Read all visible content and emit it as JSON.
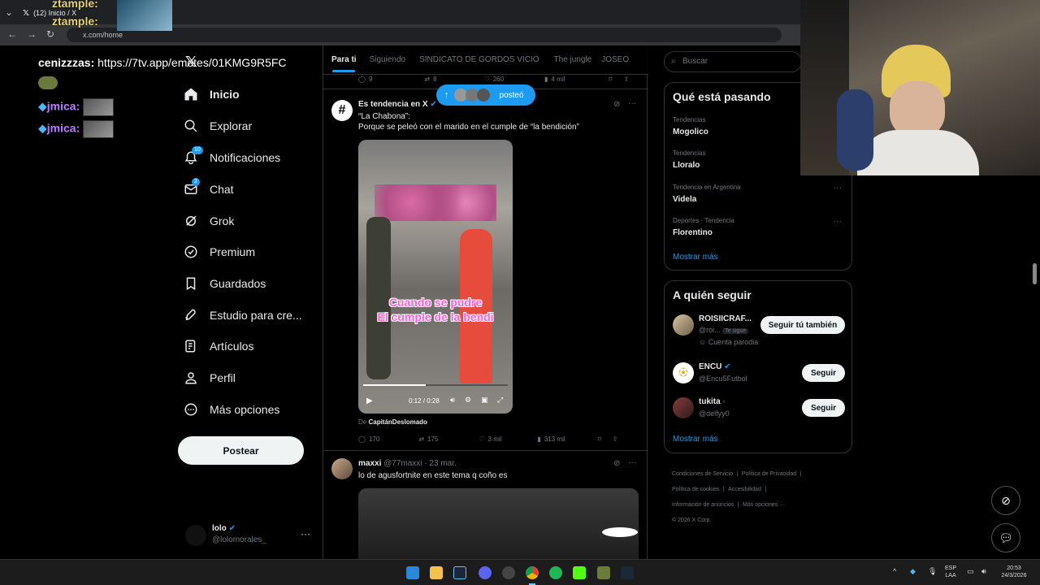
{
  "browser": {
    "tab_title": "(12) Inicio / X",
    "url": "x.com/home",
    "tab_close": "✕",
    "new_tab": "+"
  },
  "chat": {
    "top1": "ztample:",
    "top2": "ztample:",
    "line1_user": "cenizzzas:",
    "line1_text": "https://7tv.app/emotes/01KMG9R5FC",
    "line2_user": "jmica:",
    "line3_user": "jmica:"
  },
  "nav": {
    "items": [
      {
        "label": "Inicio",
        "icon": "home-icon"
      },
      {
        "label": "Explorar",
        "icon": "search-icon"
      },
      {
        "label": "Notificaciones",
        "icon": "bell-icon",
        "badge": "10"
      },
      {
        "label": "Chat",
        "icon": "mail-icon",
        "badge": "2"
      },
      {
        "label": "Grok",
        "icon": "grok-icon"
      },
      {
        "label": "Premium",
        "icon": "verified-icon"
      },
      {
        "label": "Guardados",
        "icon": "bookmark-icon"
      },
      {
        "label": "Estudio para cre...",
        "icon": "rocket-icon"
      },
      {
        "label": "Artículos",
        "icon": "article-icon"
      },
      {
        "label": "Perfil",
        "icon": "person-icon"
      },
      {
        "label": "Más opciones",
        "icon": "more-circle-icon"
      }
    ],
    "post_button": "Postear",
    "account_name": "lolo",
    "account_handle": "@lolomorales_"
  },
  "tabs": [
    "Para ti",
    "Siguiendo",
    "SINDICATO DE GORDOS VICIO",
    "The jungle",
    "JOSEO"
  ],
  "top_actions": {
    "replies": "9",
    "reposts": "8",
    "likes": "260",
    "views": "4 mil"
  },
  "new_posts_pill": "posteó",
  "tweet1": {
    "author": "Es tendencia en X",
    "line1": "“La Chabona”:",
    "line2": "Porque se peleó con el marido en el cumple de “la bendición”",
    "video_caption1": "Cuando se pudre",
    "video_caption2": "El cumple de la bendi",
    "time": "0:12 / 0:28",
    "source_prefix": "De",
    "source": "CapitánDeslomado",
    "replies": "170",
    "reposts": "175",
    "likes": "3 mil",
    "views": "313 mil"
  },
  "tweet2": {
    "author": "maxxi",
    "handle_date": "@77maxxi · 23 mar.",
    "text": "lo de agusfortnite en este tema q coño es"
  },
  "sidebar": {
    "search_placeholder": "Buscar",
    "trends_title": "Qué está pasando",
    "trends": [
      {
        "cat": "Tendencias",
        "name": "Mogolico"
      },
      {
        "cat": "Tendencias",
        "name": "Lloralo"
      },
      {
        "cat": "Tendencia en Argentina",
        "name": "Videla"
      },
      {
        "cat": "Deportes · Tendencia",
        "name": "Florentino"
      }
    ],
    "show_more": "Mostrar más",
    "follow_title": "A quién seguir",
    "follow": [
      {
        "name": "ROISIICRAF...",
        "handle": "@roi...",
        "tag": "Te sigue",
        "note": "Cuenta parodia",
        "button": "Seguir tú también"
      },
      {
        "name": "ENCU",
        "handle": "@Encu5Futbol",
        "button": "Seguir"
      },
      {
        "name": "tukita",
        "handle": "@delfyy0",
        "button": "Seguir"
      }
    ],
    "show_more2": "Mostrar más",
    "footer": [
      "Condiciones de Servicio",
      "Política de Privacidad",
      "Política de cookies",
      "Accesibilidad",
      "Información de anuncios",
      "Más opciones ···",
      "© 2026 X Corp."
    ]
  },
  "taskbar": {
    "lang1": "ESP",
    "lang2": "LAA",
    "time": "20:53",
    "date": "24/3/2026"
  },
  "colors": {
    "accent": "#1d9bf0",
    "background": "#000000",
    "border": "#2f3336"
  }
}
